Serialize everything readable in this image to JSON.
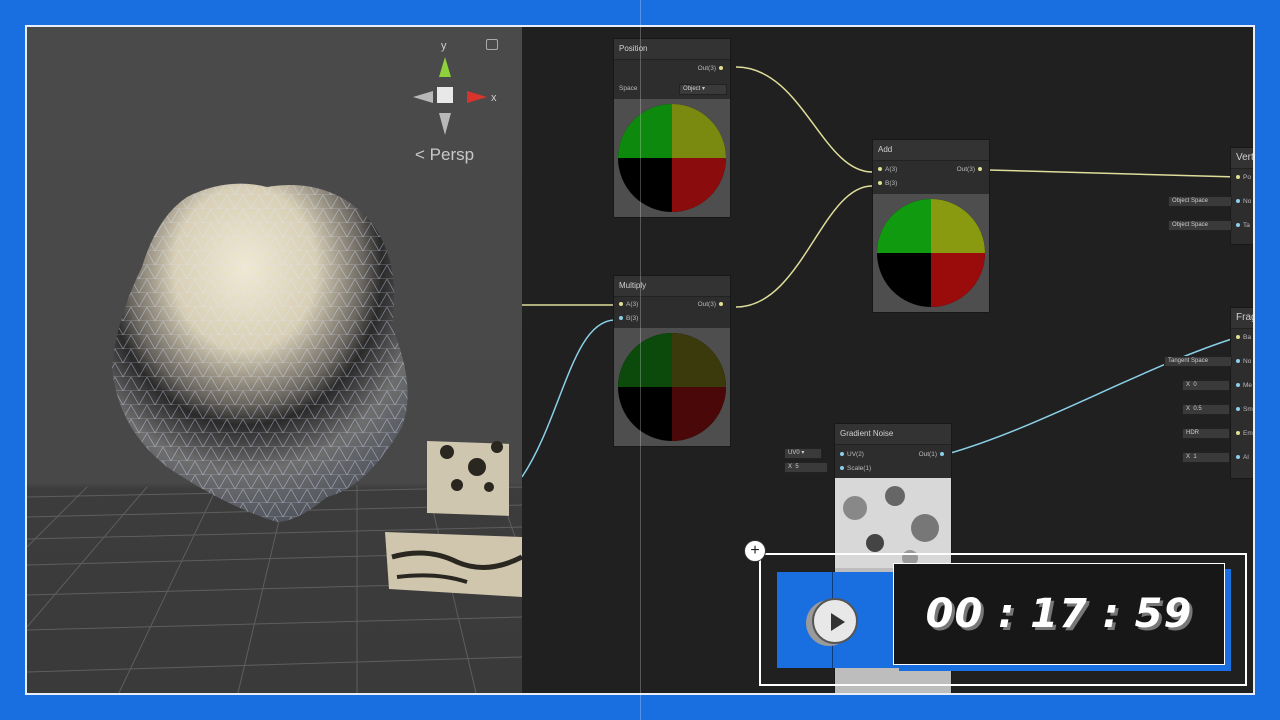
{
  "scene": {
    "view_label": "Persp",
    "axis_y": "y",
    "axis_x": "x"
  },
  "nodes": {
    "position": {
      "title": "Position",
      "out": "Out(3)",
      "space_label": "Space",
      "space_value": "Object"
    },
    "add": {
      "title": "Add",
      "in_a": "A(3)",
      "in_b": "B(3)",
      "out": "Out(3)"
    },
    "multiply": {
      "title": "Multiply",
      "in_a": "A(3)",
      "in_b": "B(3)",
      "out": "Out(3)"
    },
    "gradient_noise": {
      "title": "Gradient Noise",
      "in_uv": "UV(2)",
      "in_scale": "Scale(1)",
      "out": "Out(1)",
      "uv_field": "UV0",
      "scale_x": "X",
      "scale_value": "5"
    },
    "vertex": {
      "title": "Verte",
      "p1": "Po",
      "p2": "No",
      "p3": "Ta",
      "f1": "Object Space",
      "f2": "Object Space"
    },
    "fragment": {
      "title": "Frag",
      "p1": "Ba",
      "p2": "No",
      "p3": "Me",
      "p4": "Sm",
      "p5": "Em",
      "p6": "Al",
      "f1": "Tangent Space",
      "x3": "X",
      "v3": "0",
      "x4": "X",
      "v4": "0.5",
      "f5": "HDR",
      "x6": "X",
      "v6": "1"
    }
  },
  "timer": {
    "time": "00 : 17 : 59",
    "plus": "+"
  },
  "colors": {
    "accent": "#1a6fe0",
    "edge_yellow": "#dede9a",
    "edge_blue": "#8ad0e8"
  }
}
